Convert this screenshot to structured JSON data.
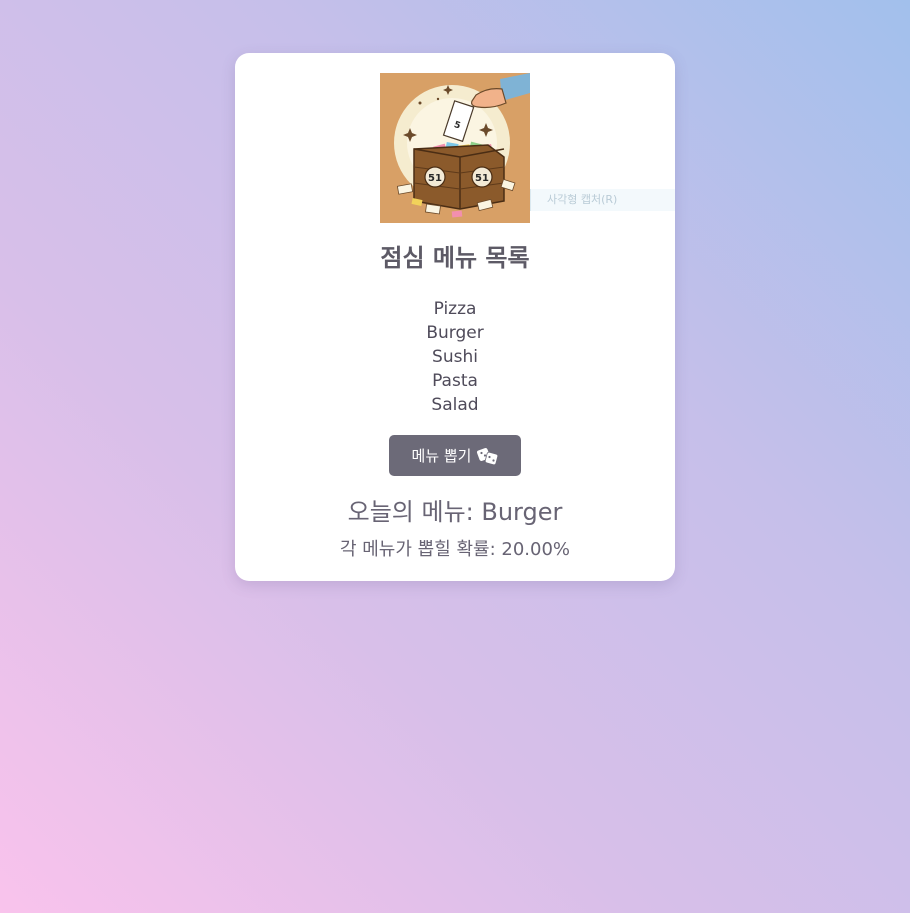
{
  "card": {
    "illustration_icon": "ballot-box-illustration",
    "capture_tip": "사각형 캡처(R)",
    "title": "점심 메뉴 목록",
    "menu_items": [
      "Pizza",
      "Burger",
      "Sushi",
      "Pasta",
      "Salad"
    ],
    "draw_button_label": "메뉴 뽑기",
    "draw_button_icon": "dice-icon",
    "result_text": "오늘의 메뉴: Burger",
    "probability_text": "각 메뉴가 뽑힐 확률: 20.00%"
  },
  "colors": {
    "button_bg": "#6c6a78",
    "text": "#5d5a66",
    "illustration_bg": "#d8a066"
  }
}
